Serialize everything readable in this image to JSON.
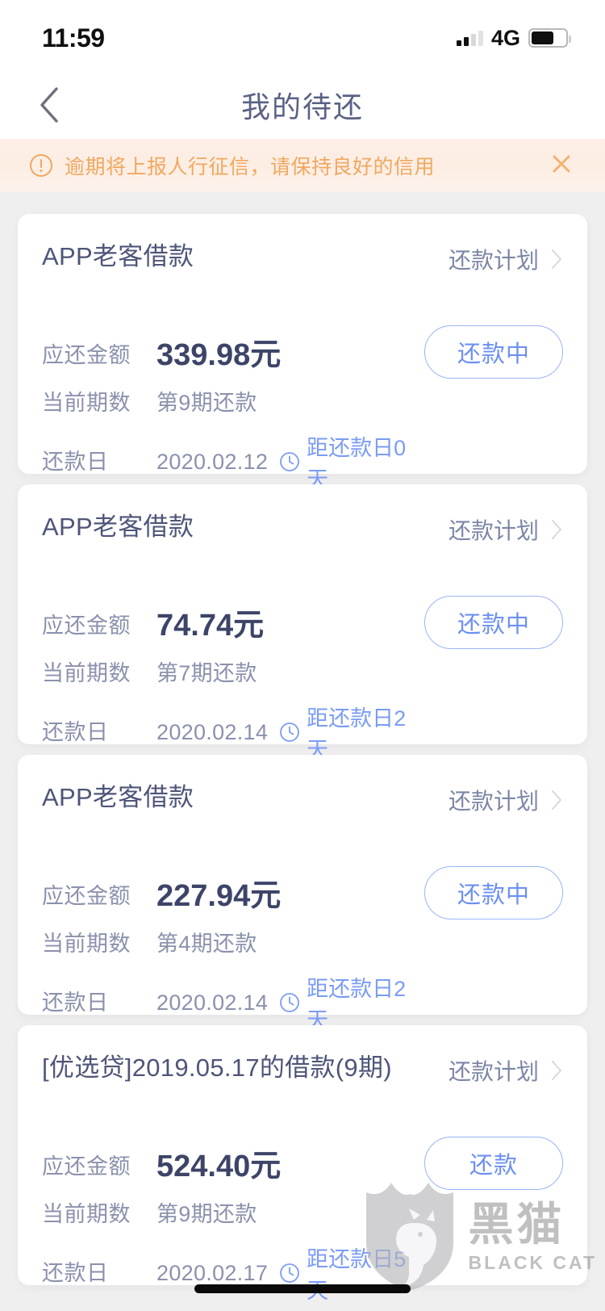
{
  "status_bar": {
    "time": "11:59",
    "network": "4G",
    "signal_icon": "signal-bars-icon",
    "battery_icon": "battery-icon",
    "battery_level": 66
  },
  "nav": {
    "back_icon": "chevron-left-icon",
    "title": "我的待还"
  },
  "banner": {
    "warn_icon": "exclamation-circle-icon",
    "text": "逾期将上报人行征信，请保持良好的信用",
    "close_icon": "close-icon",
    "text_color": "#f0a860",
    "bg_color": "#fdefe6"
  },
  "labels": {
    "amount": "应还金额",
    "period": "当前期数",
    "due_date": "还款日",
    "plan_link": "还款计划",
    "plan_chevron_icon": "chevron-right-icon",
    "clock_icon": "clock-icon"
  },
  "colors": {
    "accent_blue": "#6c90f2",
    "title_navy": "#4e5578",
    "muted": "#8b91ac",
    "page_bg": "#f0efef"
  },
  "cards": [
    {
      "title": "APP老客借款",
      "plan_label": "还款计划",
      "amount": "339.98元",
      "period": "第9期还款",
      "due_date": "2020.02.12",
      "countdown": "距还款日0天",
      "action_label": "还款中"
    },
    {
      "title": "APP老客借款",
      "plan_label": "还款计划",
      "amount": "74.74元",
      "period": "第7期还款",
      "due_date": "2020.02.14",
      "countdown": "距还款日2天",
      "action_label": "还款中"
    },
    {
      "title": "APP老客借款",
      "plan_label": "还款计划",
      "amount": "227.94元",
      "period": "第4期还款",
      "due_date": "2020.02.14",
      "countdown": "距还款日2天",
      "action_label": "还款中"
    },
    {
      "title": "[优选贷]2019.05.17的借款(9期)",
      "plan_label": "还款计划",
      "amount": "524.40元",
      "period": "第9期还款",
      "due_date": "2020.02.17",
      "countdown": "距还款日5天",
      "action_label": "还款"
    }
  ],
  "watermark": {
    "cn": "黑猫",
    "en": "BLACK CAT",
    "logo_icon": "black-cat-shield-icon"
  }
}
